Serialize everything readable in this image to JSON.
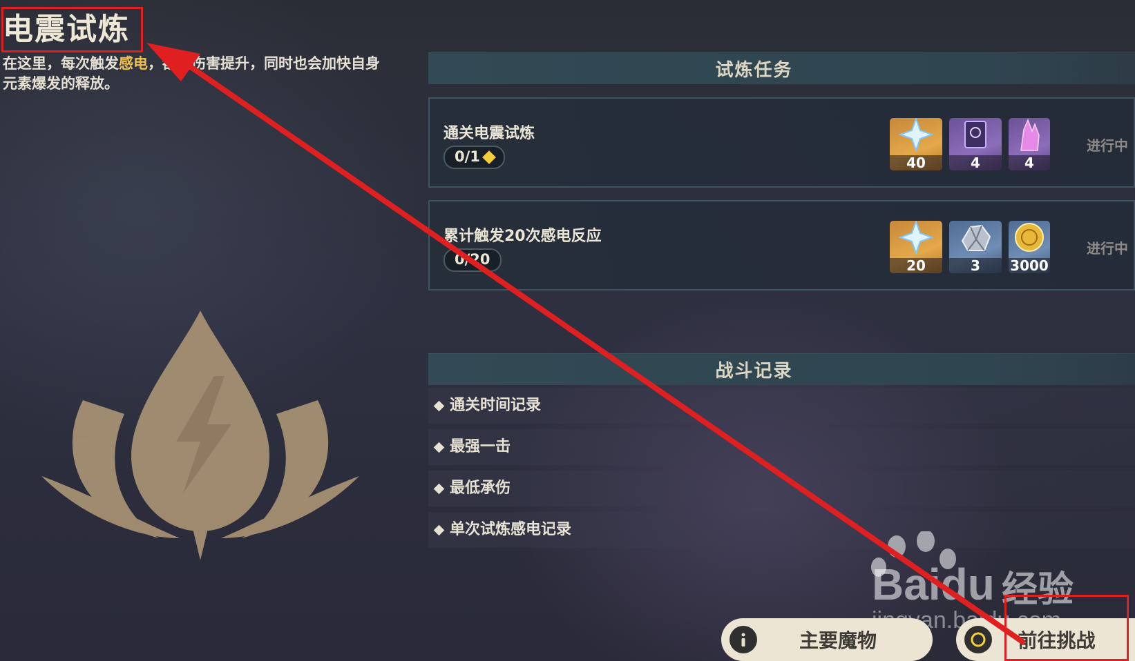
{
  "header": {
    "title": "电震试炼",
    "description_pre": "在这里，每次触发",
    "description_hl": "感电",
    "description_post": "，都会伤害提升，同时也会加快自身元素爆发的释放。"
  },
  "tasks": {
    "header": "试炼任务",
    "items": [
      {
        "name": "通关电震试炼",
        "progress": "0/1",
        "status": "进行中",
        "rewards": [
          {
            "icon": "primogem-icon",
            "count": "40"
          },
          {
            "icon": "book-icon",
            "count": "4"
          },
          {
            "icon": "crystal-icon",
            "count": "4"
          }
        ]
      },
      {
        "name": "累计触发20次感电反应",
        "progress": "0/20",
        "status": "进行中",
        "rewards": [
          {
            "icon": "primogem-icon",
            "count": "20"
          },
          {
            "icon": "ore-icon",
            "count": "3"
          },
          {
            "icon": "mora-coin-icon",
            "count": "3000"
          }
        ]
      }
    ]
  },
  "records": {
    "header": "战斗记录",
    "items": [
      "通关时间记录",
      "最强一击",
      "最低承伤",
      "单次试炼感电记录"
    ]
  },
  "buttons": {
    "monsters": "主要魔物",
    "challenge": "前往挑战"
  },
  "watermark": {
    "brand": "Bai",
    "brand_du": "du",
    "cn": "经验",
    "url": "jingyan.baidu.com"
  },
  "colors": {
    "annotation_red": "#e02020",
    "highlight": "#f2c14e",
    "panel_header": "#324a55"
  }
}
